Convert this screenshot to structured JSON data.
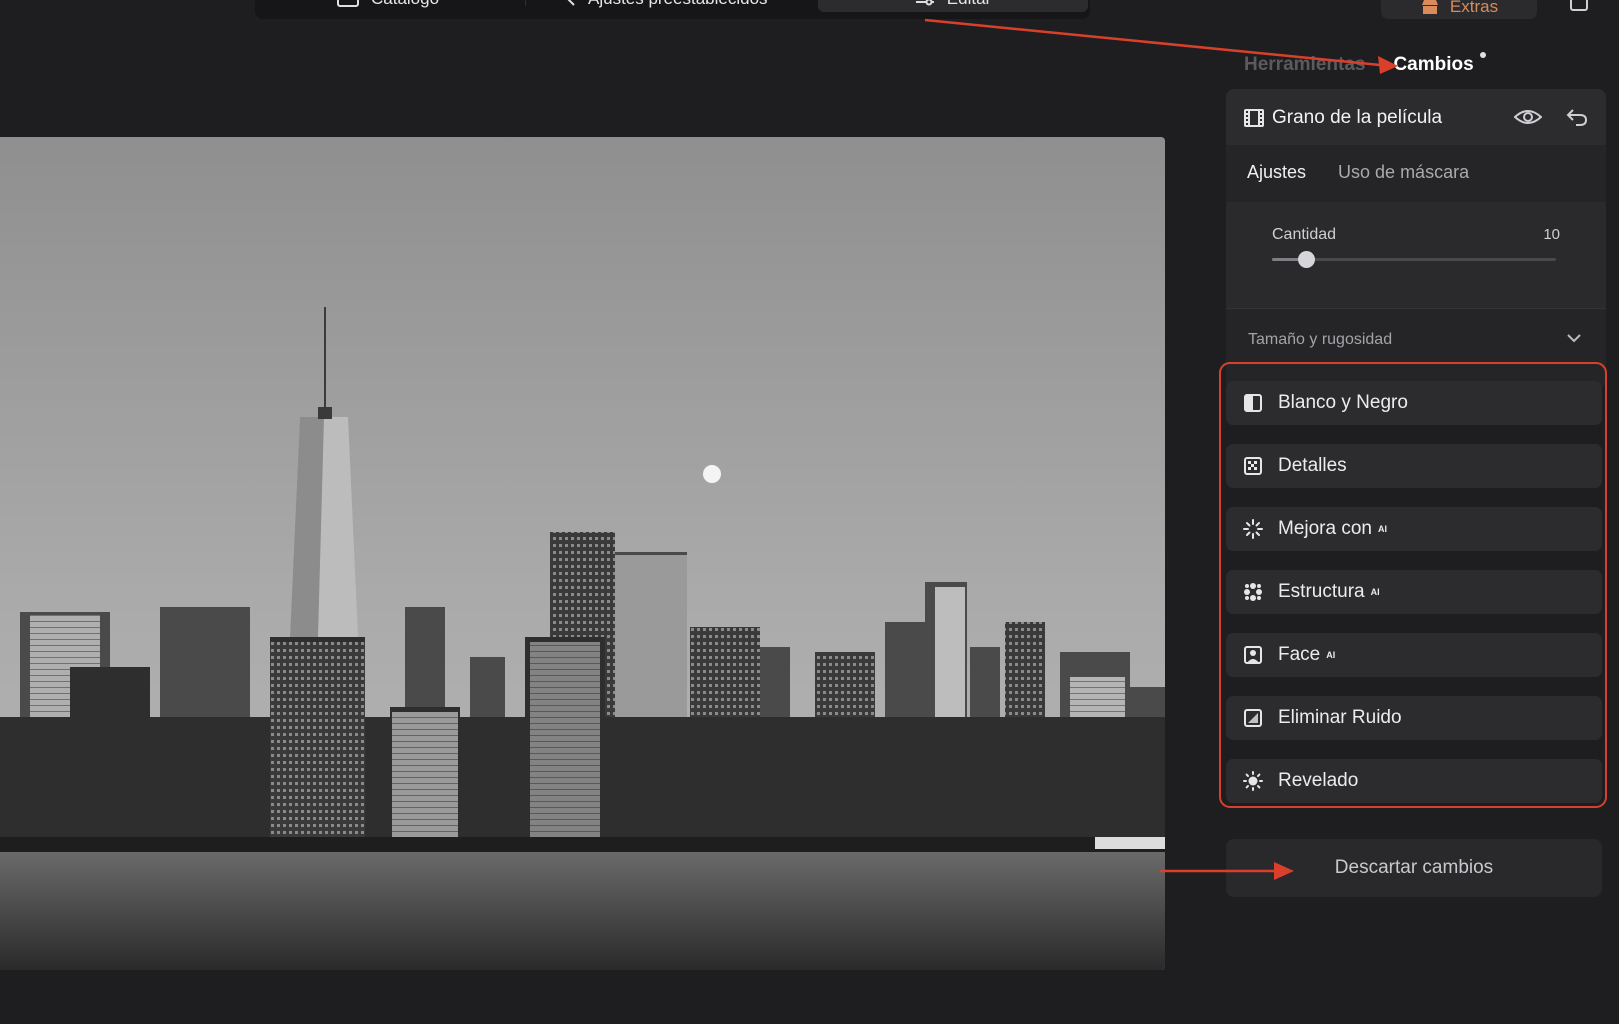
{
  "toolbar": {
    "catalog_label": "Catálogo",
    "presets_label": "Ajustes preestablecidos",
    "edit_label": "Editar",
    "extras_label": "Extras"
  },
  "panel": {
    "tabs": {
      "tools": "Herramientas",
      "changes": "Cambios"
    },
    "grain": {
      "title": "Grano de la película",
      "subtabs": {
        "settings": "Ajustes",
        "mask": "Uso de máscara"
      },
      "amount_label": "Cantidad",
      "amount_value": "10",
      "amount_fraction": 0.12,
      "size_roughness_label": "Tamaño y rugosidad"
    },
    "tools": [
      {
        "label": "Blanco y Negro",
        "icon": "black-white-icon",
        "ai": ""
      },
      {
        "label": "Detalles",
        "icon": "details-icon",
        "ai": ""
      },
      {
        "label": "Mejora con",
        "icon": "sparkle-icon",
        "ai": "AI"
      },
      {
        "label": "Estructura",
        "icon": "structure-icon",
        "ai": "AI"
      },
      {
        "label": "Face",
        "icon": "face-icon",
        "ai": "AI"
      },
      {
        "label": "Eliminar Ruido",
        "icon": "denoise-icon",
        "ai": ""
      },
      {
        "label": "Revelado",
        "icon": "sun-icon",
        "ai": ""
      }
    ],
    "discard_label": "Descartar cambios"
  },
  "colors": {
    "annotation": "#d9402b",
    "background": "#1e1e20",
    "panel_card": "#2c2c2f"
  }
}
